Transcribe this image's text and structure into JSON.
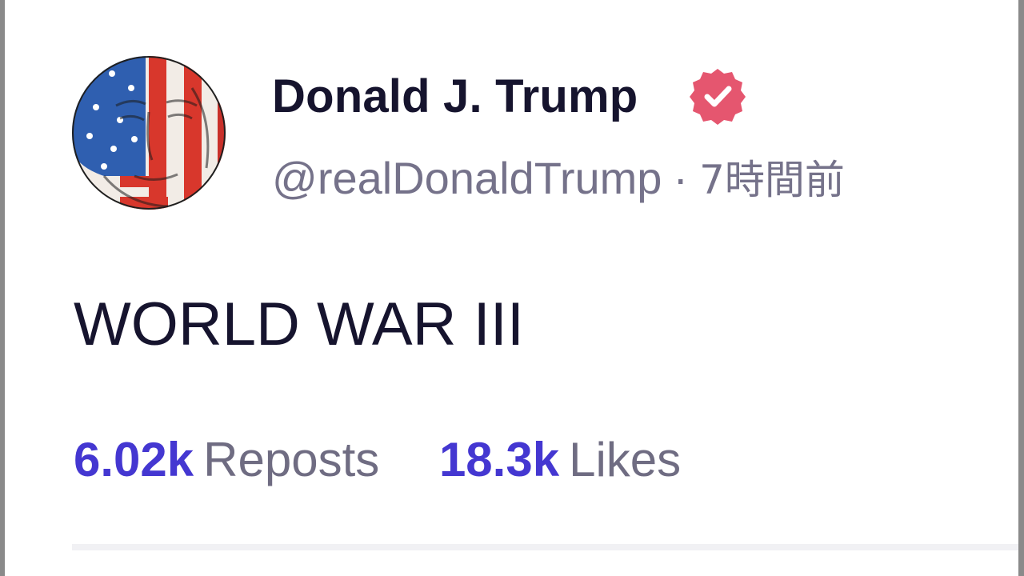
{
  "author": {
    "display_name": "Donald J. Trump",
    "verified": true,
    "handle": "@realDonaldTrump",
    "separator": "·",
    "timestamp": "7時間前"
  },
  "post": {
    "text": "WORLD WAR III"
  },
  "stats": {
    "reposts_count": "6.02k",
    "reposts_label": "Reposts",
    "likes_count": "18.3k",
    "likes_label": "Likes"
  },
  "colors": {
    "name_text": "#16142e",
    "meta_text": "#75728a",
    "stat_number": "#4437d1",
    "verified_badge": "#e5566f",
    "divider": "#f1f1f4"
  }
}
